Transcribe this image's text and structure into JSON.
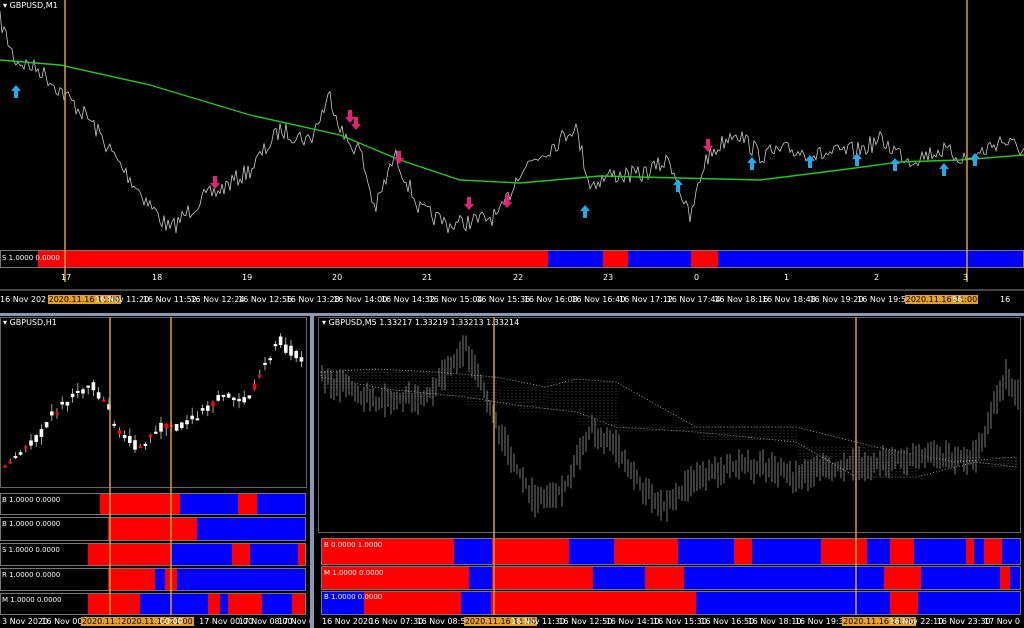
{
  "top": {
    "title": "GBPUSD,M1",
    "indicator_label": "S 1.0000 0.0000",
    "day_marks": [
      "17",
      "18",
      "19",
      "20",
      "21",
      "22",
      "23",
      "0",
      "1",
      "2",
      "3"
    ],
    "time_axis": [
      "16 Nov 202",
      "2020.11.16 11:00",
      "16 Nov 11:20",
      "16 Nov 11:52",
      "16 Nov 12:24",
      "16 Nov 12:56",
      "16 Nov 13:28",
      "16 Nov 14:00",
      "16 Nov 14:32",
      "16 Nov 15:04",
      "16 Nov 15:36",
      "16 Nov 16:08",
      "16 Nov 16:40",
      "16 Nov 17:12",
      "16 Nov 17:44",
      "16 Nov 18:16",
      "16 Nov 18:48",
      "16 Nov 19:20",
      "16 Nov 19:52",
      "2020.11.16 21:00",
      "56",
      "16"
    ]
  },
  "bottom_left": {
    "title": "GBPUSD,H1",
    "indicator_labels": [
      "B 1.0000 0.0000",
      "B 1.0000 0.0000",
      "S 1.0000 0.0000",
      "R 1.0000 0.0000",
      "M 1.0000 0.0000"
    ],
    "time_axis": [
      "3 Nov 2020",
      "16 Nov 00:",
      "2020.11.16 11:00",
      "2020.11.16 21:00",
      "00:00",
      "17 Nov 00:00",
      "17 Nov 08:00",
      "17 Nov 0"
    ]
  },
  "bottom_right": {
    "title": "GBPUSD,M5  1.33217 1.33219 1.33213 1.33214",
    "indicator_labels": [
      "B 0.0000 1.0000",
      "M 1.0000 0.0000",
      "B 1.0000 0.0000"
    ],
    "time_axis": [
      "16 Nov 2020",
      "16 Nov 07:30",
      "16 Nov 08:50",
      "2020.11.16 11:00",
      "16 Nov 11:30",
      "16 Nov 12:50",
      "16 Nov 14:10",
      "16 Nov 15:30",
      "16 Nov 16:50",
      "16 Nov 18:10",
      "16 Nov 19:30",
      "2020.11.16 21:00",
      "16 Nov 22:10",
      "16 Nov 23:30",
      "17 Nov 0"
    ]
  },
  "colors": {
    "bull": "#ff0000",
    "bear": "#0000ff",
    "ma": "#22c81e",
    "price": "#c8c8c8",
    "vline": "#d9a030",
    "up_arrow": "#22aaee",
    "down_arrow": "#e8207a"
  }
}
